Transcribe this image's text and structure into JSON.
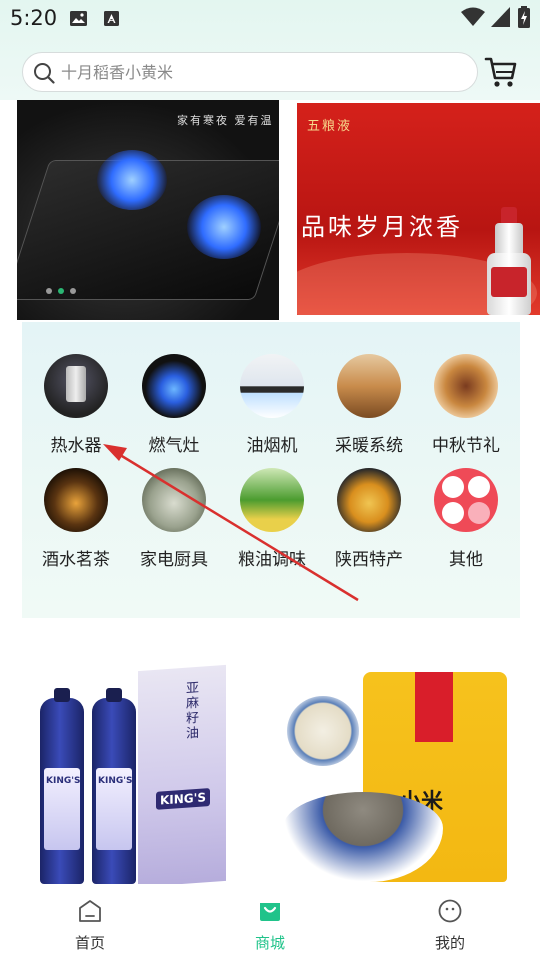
{
  "status_bar": {
    "time": "5:20"
  },
  "search": {
    "placeholder": "十月稻香小黄米"
  },
  "banners": {
    "left_slogan": "家有寒夜 爱有温",
    "right_brand": "五粮液",
    "right_tagline": "品味岁月浓香",
    "active_index": 1,
    "count": 3
  },
  "categories": [
    {
      "label": "热水器",
      "icon": "water-heater-icon"
    },
    {
      "label": "燃气灶",
      "icon": "gas-stove-icon"
    },
    {
      "label": "油烟机",
      "icon": "range-hood-icon"
    },
    {
      "label": "采暖系统",
      "icon": "heating-system-icon"
    },
    {
      "label": "中秋节礼",
      "icon": "mid-autumn-gift-icon"
    },
    {
      "label": "酒水茗茶",
      "icon": "liquor-tea-icon"
    },
    {
      "label": "家电厨具",
      "icon": "kitchen-appliance-icon"
    },
    {
      "label": "粮油调味",
      "icon": "grain-oil-icon"
    },
    {
      "label": "陕西特产",
      "icon": "shaanxi-specialty-icon"
    },
    {
      "label": "其他",
      "icon": "other-icon"
    }
  ],
  "products": {
    "left_brand": "KING'S",
    "left_book_text": "亚麻籽油",
    "right_bag_text": "小米"
  },
  "bottom_nav": [
    {
      "label": "首页",
      "icon": "home-icon",
      "active": false
    },
    {
      "label": "商城",
      "icon": "mall-bag-icon",
      "active": true
    },
    {
      "label": "我的",
      "icon": "profile-icon",
      "active": false
    }
  ],
  "colors": {
    "accent": "#20c38a",
    "arrow": "#d9302e",
    "banner_red": "#d5211b"
  }
}
